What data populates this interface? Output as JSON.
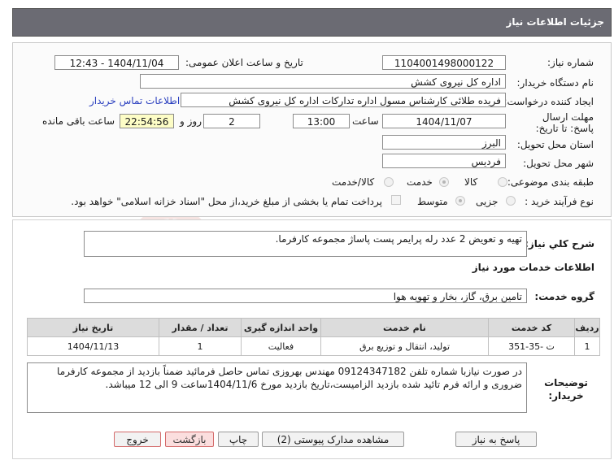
{
  "header": {
    "title": "جزئیات اطلاعات نیاز"
  },
  "form": {
    "need_number_label": "شماره نیاز:",
    "need_number": "1104001498000122",
    "announce_label": "تاریخ و ساعت اعلان عمومی:",
    "announce_value": "1404/11/04 - 12:43",
    "buyer_org_label": "نام دستگاه خریدار:",
    "buyer_org": "اداره کل نیروی کشش",
    "creator_label": "ایجاد کننده درخواست:",
    "creator": "فریده طلائی کارشناس مسول اداره تدارکات اداره کل نیروی کشش",
    "contact_link": "اطلاعات تماس خریدار",
    "deadline_label": "مهلت ارسال پاسخ: تا تاریخ:",
    "deadline_date": "1404/11/07",
    "time_label": "ساعت",
    "deadline_time": "13:00",
    "days_value": "2",
    "days_label": "روز و",
    "remaining_time": "22:54:56",
    "remaining_label": "ساعت باقی مانده",
    "province_label": "استان محل تحویل:",
    "province": "البرز",
    "city_label": "شهر محل تحویل:",
    "city": "فردیس",
    "category_label": "طبقه بندی موضوعی:",
    "category_options": [
      "کالا",
      "خدمت",
      "کالا/خدمت"
    ],
    "process_label": "نوع فرآیند خرید :",
    "process_options": [
      "جزیی",
      "متوسط"
    ],
    "payment_note": "پرداخت تمام یا بخشی از مبلغ خرید،از محل \"اسناد خزانه اسلامی\" خواهد بود."
  },
  "description": {
    "label": "شرح کلي نياز:",
    "text": "تهیه و تعویض 2 عدد رله پرایمر پست پاساژ مجموعه کارفرما."
  },
  "services": {
    "section_title": "اطلاعات خدمات مورد نیاز",
    "group_label": "گروه خدمت:",
    "group_value": "تامین برق، گاز، بخار و تهویه هوا",
    "columns": [
      "ردیف",
      "کد خدمت",
      "نام خدمت",
      "واحد اندازه گیری",
      "تعداد / مقدار",
      "تاریخ نیاز"
    ],
    "rows": [
      [
        "1",
        "ت -35-351",
        "تولید، انتقال و توزیع برق",
        "فعالیت",
        "1",
        "1404/11/13"
      ]
    ]
  },
  "buyer_notes": {
    "label": "توضیحات خریدار:",
    "text": "در صورت نیازبا شماره تلفن 09124347182 مهندس بهروزی تماس حاصل فرمائید ضمناً بازدید از مجموعه کارفرما ضروری و ارائه فرم تائید شده بازدید الزامیست،تاریخ بازدید مورخ 1404/11/6ساعت 9 الی 12 میباشد."
  },
  "buttons": {
    "reply": "پاسخ به نیاز",
    "attachments": "مشاهده مدارک پیوستی (2)",
    "print": "چاپ",
    "back": "بازگشت",
    "exit": "خروج"
  },
  "colors": {
    "header_bg": "#6b6b73",
    "link": "#2a3fbf",
    "remaining_bg": "#fdfdc6"
  }
}
